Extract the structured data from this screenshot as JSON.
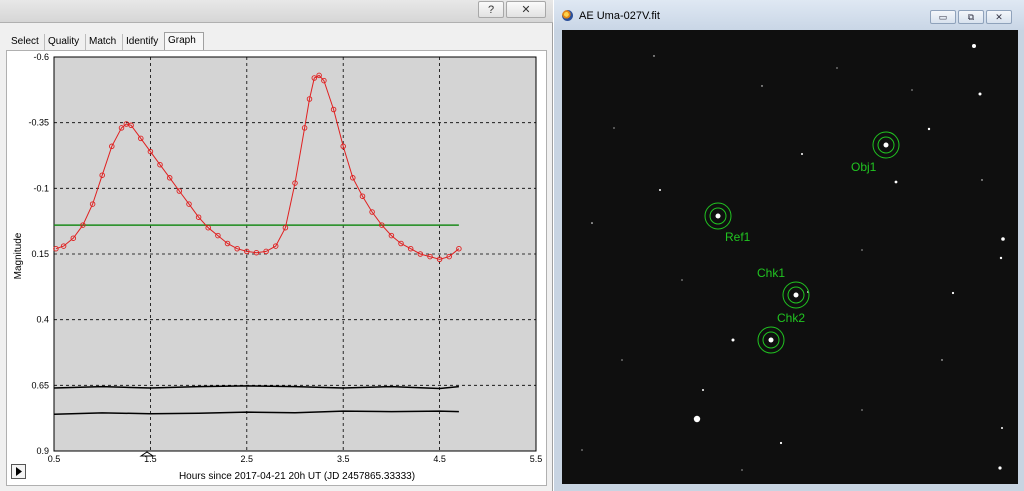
{
  "left_window": {
    "help_label": "?",
    "close_label": "✕",
    "tabs": [
      {
        "label": "Select"
      },
      {
        "label": "Quality"
      },
      {
        "label": "Match"
      },
      {
        "label": "Identify"
      },
      {
        "label": "Graph"
      }
    ],
    "active_tab": "Graph",
    "play_icon": "play-icon"
  },
  "chart_data": {
    "type": "scatter",
    "xlabel": "Hours since 2017-04-21 20h UT (JD 2457865.33333)",
    "ylabel": "Magnitude",
    "xlim": [
      0.5,
      5.5
    ],
    "ylim": [
      -0.6,
      0.9
    ],
    "y_inverted": true,
    "x_ticks": [
      0.5,
      1.5,
      2.5,
      3.5,
      4.5,
      5.5
    ],
    "x_tick_labels": [
      "0.5",
      "1.5",
      "2.5",
      "3.5",
      "4.5",
      "5.5"
    ],
    "y_ticks": [
      -0.6,
      -0.35,
      -0.1,
      0.15,
      0.4,
      0.65,
      0.9
    ],
    "y_tick_labels": [
      "-0.6",
      "-0.35",
      "-0.1",
      "0.15",
      "0.4",
      "0.65",
      "0.9"
    ],
    "grid": true,
    "colors": {
      "variable": "#e02020",
      "reference": "#1a8a1a",
      "check": "#000000",
      "plot_bg": "#d4d4d4"
    },
    "series": [
      {
        "points": [
          [
            0.52,
            0.13
          ],
          [
            0.6,
            0.12
          ],
          [
            0.7,
            0.09
          ],
          [
            0.8,
            0.04
          ],
          [
            0.9,
            -0.04
          ],
          [
            1.0,
            -0.15
          ],
          [
            1.1,
            -0.26
          ],
          [
            1.2,
            -0.33
          ],
          [
            1.25,
            -0.345
          ],
          [
            1.3,
            -0.34
          ],
          [
            1.4,
            -0.29
          ],
          [
            1.5,
            -0.24
          ],
          [
            1.6,
            -0.19
          ],
          [
            1.7,
            -0.14
          ],
          [
            1.8,
            -0.09
          ],
          [
            1.9,
            -0.04
          ],
          [
            2.0,
            0.01
          ],
          [
            2.1,
            0.05
          ],
          [
            2.2,
            0.08
          ],
          [
            2.3,
            0.11
          ],
          [
            2.4,
            0.13
          ],
          [
            2.5,
            0.14
          ],
          [
            2.6,
            0.145
          ],
          [
            2.7,
            0.14
          ],
          [
            2.8,
            0.12
          ],
          [
            2.9,
            0.05
          ],
          [
            3.0,
            -0.12
          ],
          [
            3.1,
            -0.33
          ],
          [
            3.15,
            -0.44
          ],
          [
            3.2,
            -0.52
          ],
          [
            3.25,
            -0.53
          ],
          [
            3.3,
            -0.51
          ],
          [
            3.4,
            -0.4
          ],
          [
            3.5,
            -0.26
          ],
          [
            3.6,
            -0.14
          ],
          [
            3.7,
            -0.07
          ],
          [
            3.8,
            -0.01
          ],
          [
            3.9,
            0.04
          ],
          [
            4.0,
            0.08
          ],
          [
            4.1,
            0.11
          ],
          [
            4.2,
            0.13
          ],
          [
            4.3,
            0.15
          ],
          [
            4.4,
            0.16
          ],
          [
            4.5,
            0.17
          ],
          [
            4.6,
            0.16
          ],
          [
            4.7,
            0.13
          ]
        ]
      },
      {
        "value": 0.04
      },
      {
        "points": [
          [
            0.5,
            0.66
          ],
          [
            1.0,
            0.655
          ],
          [
            1.5,
            0.66
          ],
          [
            2.0,
            0.655
          ],
          [
            2.5,
            0.652
          ],
          [
            3.0,
            0.655
          ],
          [
            3.5,
            0.66
          ],
          [
            4.0,
            0.655
          ],
          [
            4.5,
            0.662
          ],
          [
            4.7,
            0.655
          ]
        ]
      },
      {
        "points": [
          [
            0.5,
            0.76
          ],
          [
            1.0,
            0.755
          ],
          [
            1.5,
            0.758
          ],
          [
            2.0,
            0.756
          ],
          [
            2.5,
            0.752
          ],
          [
            3.0,
            0.754
          ],
          [
            3.5,
            0.748
          ],
          [
            4.0,
            0.75
          ],
          [
            4.5,
            0.748
          ],
          [
            4.7,
            0.75
          ]
        ]
      }
    ]
  },
  "right_window": {
    "title": "AE Uma-027V.fit",
    "minimize_label": "▭",
    "restore_label": "⧉",
    "close_label": "✕",
    "stars": [
      {
        "label": "Obj1"
      },
      {
        "label": "Ref1"
      },
      {
        "label": "Chk1"
      },
      {
        "label": "Chk2"
      },
      {
        "label": ""
      }
    ]
  }
}
